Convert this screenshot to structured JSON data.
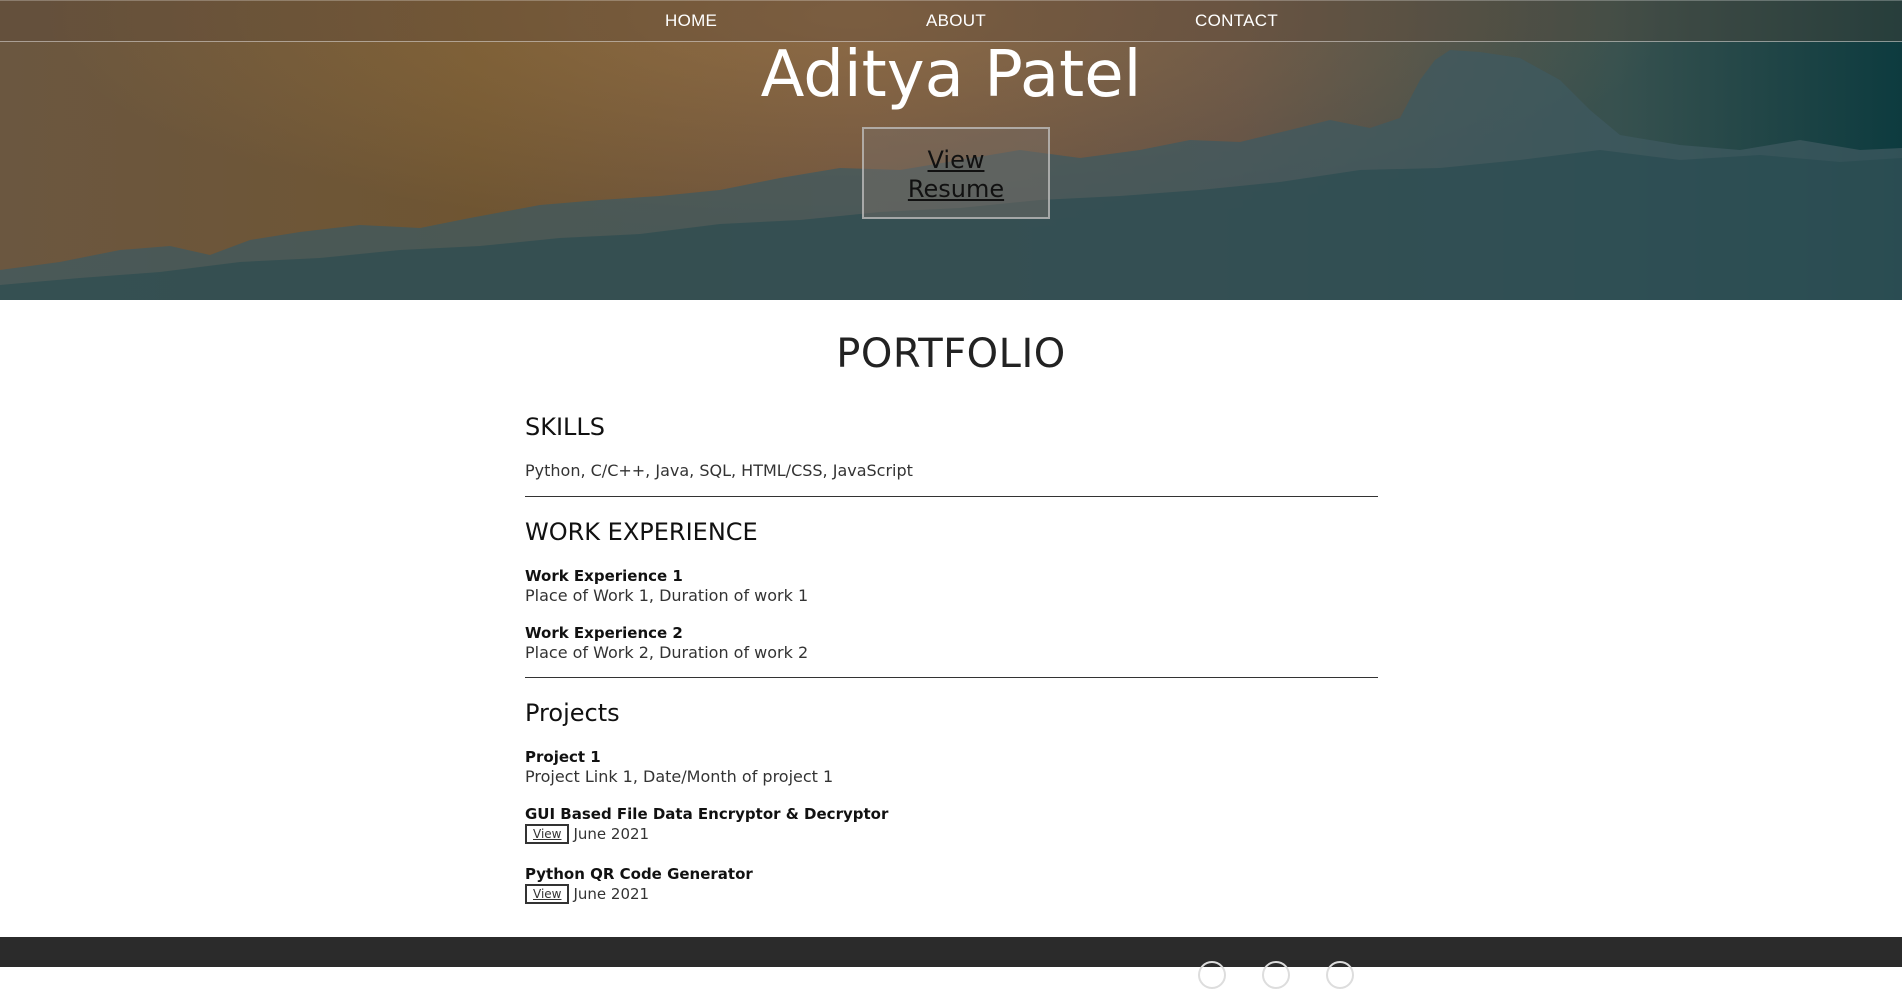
{
  "nav": {
    "items": [
      {
        "label": "HOME"
      },
      {
        "label": "ABOUT"
      },
      {
        "label": "CONTACT"
      }
    ]
  },
  "hero": {
    "name": "Aditya Patel",
    "resume_line1": "View",
    "resume_line2": "Resume"
  },
  "portfolio": {
    "title": "PORTFOLIO",
    "skills": {
      "heading": "SKILLS",
      "text": "Python, C/C++, Java, SQL, HTML/CSS, JavaScript"
    },
    "work": {
      "heading": "WORK EXPERIENCE",
      "items": [
        {
          "title": "Work Experience 1",
          "detail": "Place of Work 1, Duration of work 1"
        },
        {
          "title": "Work Experience 2",
          "detail": "Place of Work 2, Duration of work 2"
        }
      ]
    },
    "projects": {
      "heading": "Projects",
      "placeholder": {
        "title": "Project 1",
        "detail": "Project Link 1, Date/Month of project 1"
      },
      "items": [
        {
          "title": "GUI Based File Data Encryptor & Decryptor",
          "view_label": "View",
          "date": "June 2021"
        },
        {
          "title": "Python QR Code Generator",
          "view_label": "View",
          "date": "June 2021"
        }
      ]
    }
  },
  "footer": {
    "social_icons": [
      "social-icon-1",
      "social-icon-2",
      "social-icon-3"
    ]
  },
  "colors": {
    "footer_bg": "#2b2b2b",
    "hero_teal": "#0d3b3f",
    "hero_orange": "#6f5532"
  }
}
